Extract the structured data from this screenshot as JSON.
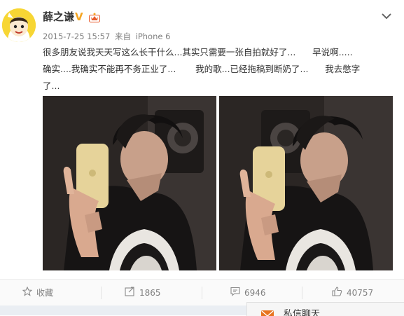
{
  "user": {
    "name": "薛之谦",
    "vip_badge": "V"
  },
  "meta": {
    "timestamp": "2015-7-25 15:57",
    "source_prefix": "来自",
    "device": "iPhone 6"
  },
  "post_text": "很多朋友说我天天写这么长干什么...其实只需要一张自拍就好了...      早说啊.....          确实....我确实不能再不务正业了...       我的歌...已经拖稿到断奶了...      我去憋字了...",
  "actions": {
    "favorite_label": "收藏",
    "repost_count": "1865",
    "comment_count": "6946",
    "like_count": "40757"
  },
  "chat": {
    "label": "私信聊天"
  },
  "colors": {
    "avatar_bg": "#f7d634",
    "vip": "#f5a623",
    "chat_icon": "#e8731f"
  }
}
